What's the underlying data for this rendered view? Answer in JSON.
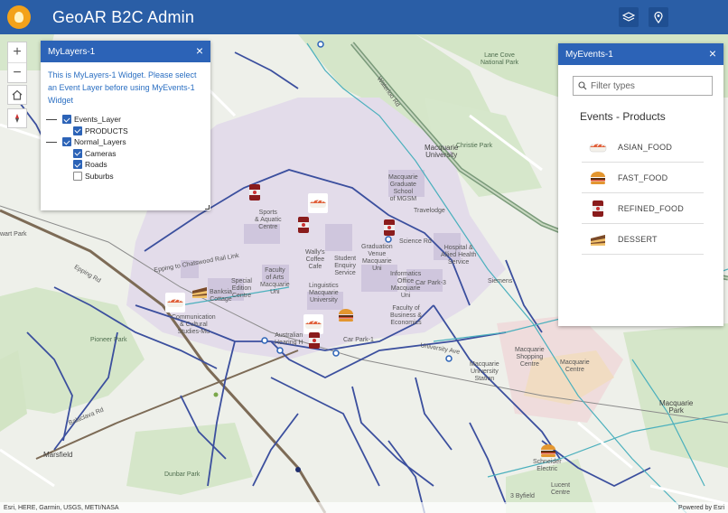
{
  "header": {
    "title": "GeoAR B2C Admin",
    "layers_icon": "layers-icon",
    "locate_icon": "pin-icon"
  },
  "controls": {
    "zoom_in": "+",
    "zoom_out": "−",
    "home_icon": "home-icon",
    "compass_icon": "compass-icon"
  },
  "layers_widget": {
    "title": "MyLayers-1",
    "close": "×",
    "description": "This is MyLayers-1 Widget. Please select an Event Layer before using MyEvents-1 Widget",
    "groups": [
      {
        "label": "Events_Layer",
        "checked": true,
        "children": [
          {
            "label": "PRODUCTS",
            "checked": true
          }
        ]
      },
      {
        "label": "Normal_Layers",
        "checked": true,
        "children": [
          {
            "label": "Cameras",
            "checked": true
          },
          {
            "label": "Roads",
            "checked": true
          },
          {
            "label": "Suburbs",
            "checked": false
          }
        ]
      }
    ]
  },
  "events_widget": {
    "title": "MyEvents-1",
    "close": "×",
    "filter_placeholder": "Filter types",
    "heading": "Events - Products",
    "items": [
      {
        "label": "ASIAN_FOOD",
        "icon": "sushi-icon"
      },
      {
        "label": "FAST_FOOD",
        "icon": "burger-icon"
      },
      {
        "label": "REFINED_FOOD",
        "icon": "can-icon"
      },
      {
        "label": "DESSERT",
        "icon": "cake-icon"
      }
    ]
  },
  "map_labels": {
    "lane_cove": "Lane Cove\nNational Park",
    "christie": "Christie Park",
    "macq_uni": "Macquarie\nUniversity",
    "macq_grad": "Macquarie\nGraduate\nSchool\nof MGSM",
    "travelodge": "Travelodge",
    "sports": "Sports\n& Aquatic\nCentre",
    "wallys": "Wally's\nCoffee\nCafe",
    "student": "Student\nEnquiry\nService",
    "grad_venue": "Graduation\nVenue\nMacquarie\nUni",
    "science_rd": "Science Rd",
    "hospital": "Hospital &\nAllied Health\nService",
    "faculty_arts": "Faculty\nof Arts\nMacquarie\nUni",
    "linguistics": "Linguistics\nMacquarie\nUniversity",
    "info_office": "Informatics\nOffice\nMacquarie\nUni",
    "car_park3": "Car Park-3",
    "siemens": "Siemens",
    "banksia": "Banksia\nCottage",
    "special": "Special\nEdition\nCentre",
    "comm": "Communication\n& Cultural\nStudies-Mu",
    "fac_business": "Faculty of\nBusiness &\nEconomics",
    "australian": "Australian\nHearing H",
    "car_park1": "Car Park-1",
    "pioneer": "Pioneer Park",
    "macq_shopping": "Macquarie\nShopping\nCentre",
    "macq_centre": "Macquarie\nCentre",
    "macq_station": "Macquarie\nUniversity\nStation",
    "macq_park": "Macquarie\nPark",
    "dunbar": "Dunbar Park",
    "marsfield": "Marsfield",
    "schneider": "Schneider\nElectric",
    "lucent": "Lucent\nCentre",
    "byfield": "3 Byfield",
    "epping_rail": "Epping to Chatswood Rail Link",
    "epping_rd": "Epping Rd",
    "balaclava": "Balaclava Rd",
    "university_ave": "University Ave",
    "waterloo": "Waterloo Rd",
    "stewart": "wart Park"
  },
  "attribution": {
    "left": "Esri, HERE, Garmin, USGS, METI/NASA",
    "right": "Powered by Esri"
  }
}
